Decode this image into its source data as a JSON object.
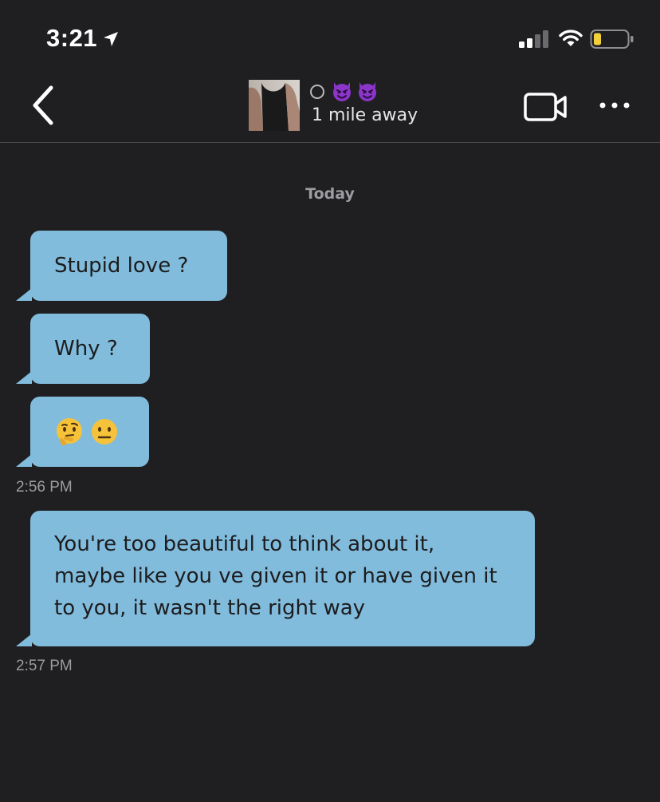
{
  "status_bar": {
    "time": "3:21",
    "icons": [
      "location-arrow-icon",
      "cellular-signal-icon",
      "wifi-icon",
      "battery-low-icon"
    ]
  },
  "header": {
    "back_icon": "chevron-left-icon",
    "profile": {
      "status_icon": "offline-circle-icon",
      "emojis": [
        "smiling-devil-emoji",
        "smiling-devil-emoji"
      ],
      "distance": "1 mile away"
    },
    "actions": [
      "video-camera-icon",
      "more-options-icon"
    ]
  },
  "chat": {
    "date_divider": "Today",
    "messages": [
      {
        "text": "Stupid love ?"
      },
      {
        "text": "Why ?"
      },
      {
        "emojis": [
          "thinking-face-emoji",
          "neutral-face-emoji"
        ]
      },
      {
        "text": "You're too beautiful to think about it, maybe like you ve given it or have given it to you, it wasn't the right way"
      }
    ],
    "timestamps": [
      "2:56 PM",
      "2:57 PM"
    ]
  },
  "colors": {
    "background": "#1f1f21",
    "bubble": "#82bcdc",
    "bubble_text": "#1c1c1e",
    "muted_text": "#9c9ca1",
    "battery_level": "#f2d03b"
  }
}
